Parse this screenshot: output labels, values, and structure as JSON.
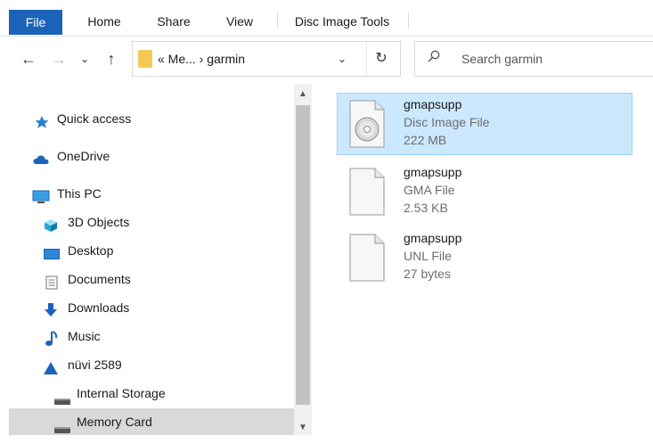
{
  "ribbon": {
    "tabs": [
      "File",
      "Home",
      "Share",
      "View",
      "Disc Image Tools"
    ]
  },
  "nav": {
    "back_icon": "←",
    "forward_icon": "→",
    "recent_icon": "⌄",
    "up_icon": "↑",
    "address_text": "« Me... › garmin",
    "address_dropdown": "⌄",
    "refresh_icon": "↻",
    "search_placeholder": "Search garmin"
  },
  "sidebar": {
    "items": [
      {
        "label": "Quick access",
        "icon": "star-icon"
      },
      {
        "label": "OneDrive",
        "icon": "cloud-icon"
      },
      {
        "label": "This PC",
        "icon": "computer-icon"
      },
      {
        "label": "3D Objects",
        "icon": "cube-icon"
      },
      {
        "label": "Desktop",
        "icon": "desktop-icon"
      },
      {
        "label": "Documents",
        "icon": "document-icon"
      },
      {
        "label": "Downloads",
        "icon": "download-icon"
      },
      {
        "label": "Music",
        "icon": "music-icon"
      },
      {
        "label": "nüvi 2589",
        "icon": "device-icon"
      },
      {
        "label": "Internal Storage",
        "icon": "drive-icon"
      },
      {
        "label": "Memory Card",
        "icon": "drive-icon"
      }
    ]
  },
  "files": [
    {
      "name": "gmapsupp",
      "type": "Disc Image File",
      "size": "222 MB",
      "icon": "disc-image-icon"
    },
    {
      "name": "gmapsupp",
      "type": "GMA File",
      "size": "2.53 KB",
      "icon": "file-icon"
    },
    {
      "name": "gmapsupp",
      "type": "UNL File",
      "size": "27 bytes",
      "icon": "file-icon"
    }
  ],
  "colors": {
    "file_tab": "#1a63b8",
    "selection": "#cce8ff",
    "sidebar_selected": "#d9d9d9"
  }
}
